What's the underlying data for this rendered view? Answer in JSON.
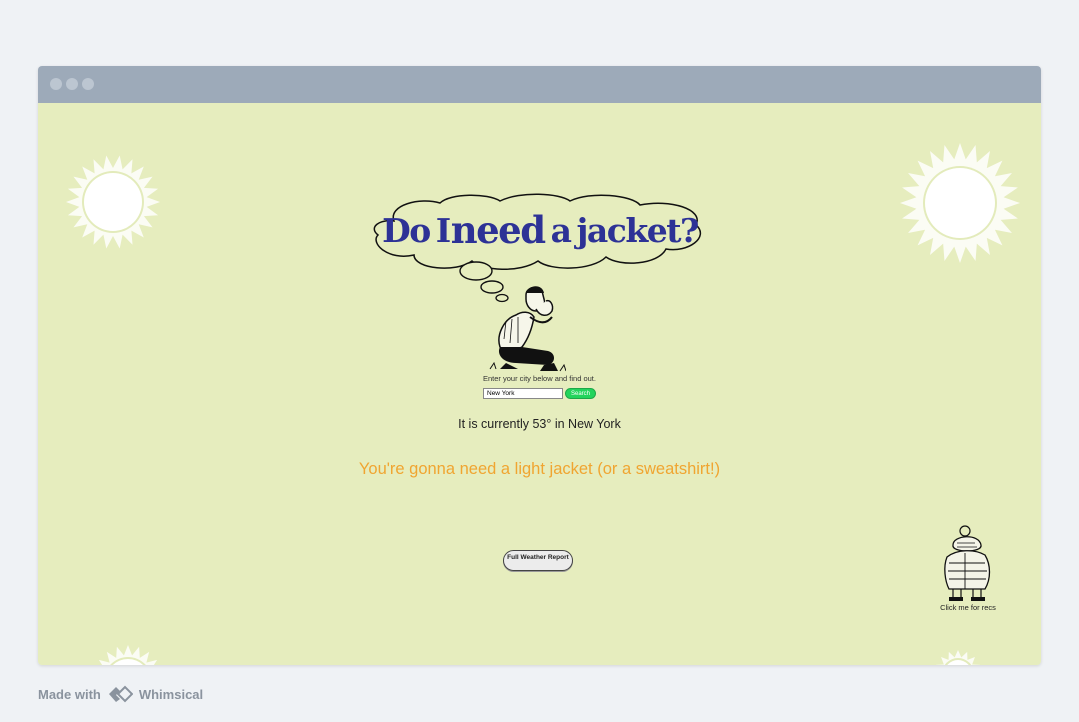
{
  "browser": {
    "window_controls": [
      "close-dot",
      "minimize-dot",
      "maximize-dot"
    ]
  },
  "hero": {
    "headline_parts": [
      "Do",
      "I",
      "need",
      "a",
      "jacket?"
    ]
  },
  "search": {
    "prompt": "Enter your city below and find out.",
    "city_value": "New York",
    "button_label": "Search"
  },
  "result": {
    "current_text": "It is currently 53° in New York",
    "recommendation": "You're gonna need a light jacket (or a sweatshirt!)"
  },
  "actions": {
    "report_label": "Full Weather Report",
    "recs_label": "Click me for recs"
  },
  "footer": {
    "made_with": "Made with",
    "brand": "Whimsical"
  },
  "colors": {
    "page_bg": "#e6edbe",
    "headline": "#2d3296",
    "recommendation": "#f0a531",
    "search_button": "#23d45c",
    "titlebar": "#9daab9"
  },
  "icons": [
    "sun-icon",
    "thought-cloud-icon",
    "thinking-man-icon",
    "bundled-person-icon",
    "whimsical-logo-icon"
  ]
}
